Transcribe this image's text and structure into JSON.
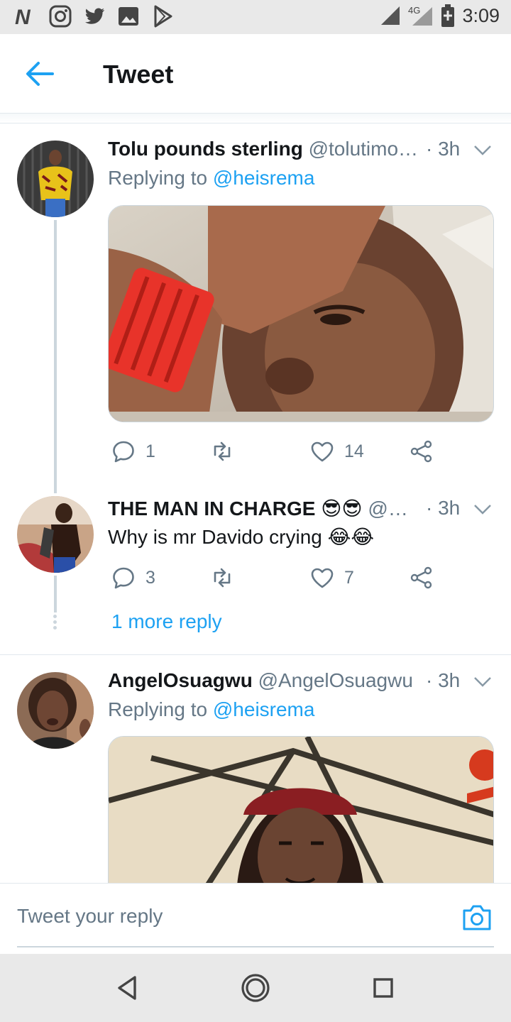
{
  "status_bar": {
    "time": "3:09",
    "network": "4G",
    "left_icons": [
      "nairaland-icon",
      "instagram-icon",
      "twitter-icon",
      "gallery-icon",
      "play-store-icon"
    ]
  },
  "header": {
    "title": "Tweet",
    "back_icon": "back-arrow-icon"
  },
  "tweets": [
    {
      "name": "Tolu pounds sterling",
      "handle": "@tolutimo…",
      "time": "· 3h",
      "replying_prefix": "Replying to",
      "replying_to": "@heisrema",
      "media": "image-crying-man-red-watch",
      "actions": {
        "replies": "1",
        "retweets": "",
        "likes": "14"
      }
    },
    {
      "name": "THE MAN IN CHARGE 😎😎",
      "handle": "@…",
      "time": "· 3h",
      "text": "Why is mr Davido crying 😂😂",
      "actions": {
        "replies": "3",
        "retweets": "",
        "likes": "7"
      }
    },
    {
      "name": "AngelOsuagwu",
      "handle": "@AngelOsuagwu",
      "time": "· 3h",
      "replying_prefix": "Replying to",
      "replying_to": "@heisrema",
      "media": "image-man-in-red-cap"
    }
  ],
  "more_replies": "1 more reply",
  "composer": {
    "placeholder": "Tweet your reply",
    "camera_icon": "camera-icon"
  },
  "nav_bar": {
    "buttons": [
      "back-triangle-icon",
      "home-circle-icon",
      "recents-square-icon"
    ]
  },
  "colors": {
    "accent": "#1da1f2",
    "secondary_text": "#657786",
    "primary_text": "#14171a",
    "divider": "#e1e8ed"
  }
}
